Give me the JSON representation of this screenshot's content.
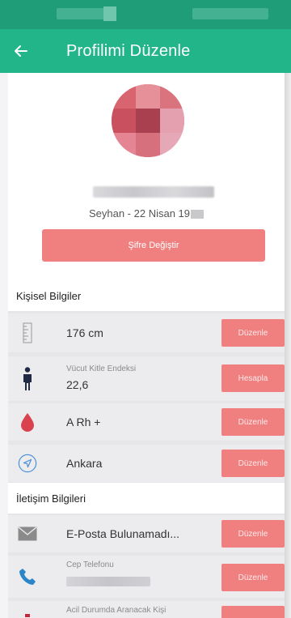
{
  "header": {
    "title": "Profilimi Düzenle"
  },
  "profile": {
    "birth_text": "Seyhan - 22 Nisan 19",
    "password_button": "Şifre Değiştir"
  },
  "sections": {
    "personal": "Kişisel Bilgiler",
    "contact": "İletişim Bilgileri"
  },
  "personal_rows": [
    {
      "value": "176 cm",
      "button": "Düzenle"
    },
    {
      "sub": "Vücut Kitle Endeksi",
      "value": "22,6",
      "button": "Hesapla"
    },
    {
      "value": "A Rh +",
      "button": "Düzenle"
    },
    {
      "value": "Ankara",
      "button": "Düzenle"
    }
  ],
  "contact_rows": [
    {
      "value": "E-Posta Bulunamadı...",
      "button": "Düzenle"
    },
    {
      "sub": "Cep Telefonu",
      "button": "Düzenle"
    },
    {
      "sub": "Acil Durumda Aranacak Kişi"
    }
  ],
  "colors": {
    "primary": "#22b58a",
    "status": "#1f9d78",
    "accent": "#f08080"
  }
}
